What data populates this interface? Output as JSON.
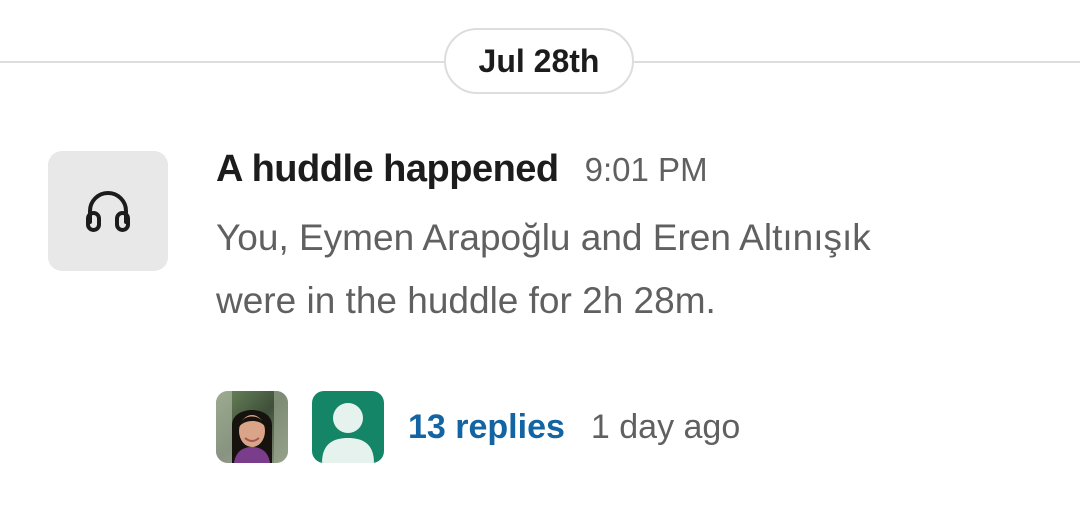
{
  "date_divider": {
    "label": "Jul 28th"
  },
  "message": {
    "icon": "headphones-icon",
    "title": "A huddle happened",
    "time": "9:01 PM",
    "body_line1": "You, Eymen Arapoğlu and Eren Altınışık",
    "body_line2": "were in the huddle for 2h 28m."
  },
  "thread": {
    "avatars": [
      "user-photo-avatar",
      "default-user-avatar"
    ],
    "replies_label": "13 replies",
    "last_reply": "1 day ago"
  },
  "colors": {
    "link": "#1264a3",
    "muted_text": "#616061",
    "primary_text": "#1d1c1d",
    "default_avatar_bg": "#148567",
    "icon_box_bg": "#e8e8e8"
  }
}
